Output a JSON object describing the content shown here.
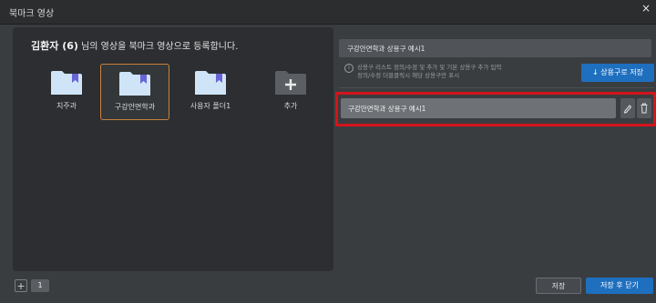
{
  "window": {
    "title": "북마크 영상",
    "close_glyph": "×"
  },
  "heading": {
    "name": "김환자 (6)",
    "suffix": " 님의 영상을 북마크 영상으로 등록합니다."
  },
  "folders": [
    {
      "label": "치주과",
      "icon": "bookmark-folder-icon",
      "selected": false
    },
    {
      "label": "구강안면학과",
      "icon": "bookmark-folder-icon",
      "selected": true
    },
    {
      "label": "사용자 폴더1",
      "icon": "bookmark-folder-icon",
      "selected": false
    },
    {
      "label": "추가",
      "icon": "add-folder-icon",
      "selected": false
    }
  ],
  "section_input": {
    "value": "구강안면학과 상용구 예시1"
  },
  "info": {
    "line1": "상용구 리스트 정의/수정 및 추가 및 기본 상용구 추가 입력",
    "line2": "정의/수정 더블클릭시 해당 상용구만 표시"
  },
  "save_section_button": {
    "label": "↓ 상용구로 저장"
  },
  "sections": [
    {
      "label": "구강안면학과 상용구 예시1"
    }
  ],
  "footer": {
    "add_glyph": "+",
    "page": "1",
    "save_label": "저장",
    "save_close_label": "저장 후 닫기"
  },
  "colors": {
    "accent": "#1f6fbf",
    "selected_border": "#c9823f",
    "highlight": "#d4141c",
    "folder": "#cfe4f7",
    "bookmark": "#6a63d8"
  }
}
